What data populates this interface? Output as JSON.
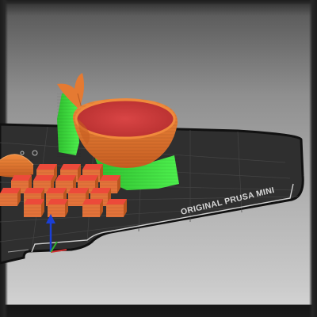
{
  "app": {
    "viewport": "3D plater preview"
  },
  "bed": {
    "label": "ORIGINAL PRUSA MINI",
    "colors": {
      "surface": "#3a3a3a",
      "edge": "#111111",
      "grid": "#4a4a4a",
      "outline": "#d8d8d8"
    }
  },
  "objects": [
    {
      "name": "whale-bowl",
      "color": "#e57a32",
      "inner_color": "#c93c3c"
    },
    {
      "name": "support-structures",
      "color": "#3bd93b"
    },
    {
      "name": "cube-array",
      "color": "#e3733a",
      "top_color": "#ec4a3a",
      "count": 17
    },
    {
      "name": "partial-dome",
      "color": "#e57a32"
    }
  ],
  "axes": {
    "z_color": "#1a3fd6",
    "x_color": "#d03030",
    "y_color": "#30b030"
  }
}
